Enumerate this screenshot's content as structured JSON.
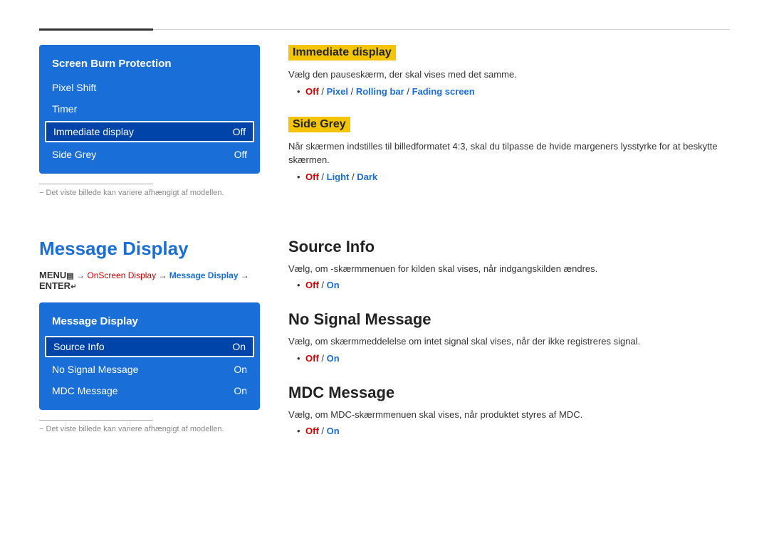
{
  "topDivider": true,
  "screenBurn": {
    "title": "Screen Burn Protection",
    "items": [
      {
        "label": "Pixel Shift",
        "value": "",
        "selected": false
      },
      {
        "label": "Timer",
        "value": "",
        "selected": false
      },
      {
        "label": "Immediate display",
        "value": "Off",
        "selected": true
      },
      {
        "label": "Side Grey",
        "value": "Off",
        "selected": false
      }
    ]
  },
  "immediateDisplay": {
    "title": "Immediate display",
    "desc": "Vælg den pauseskærm, der skal vises med det samme.",
    "options": "Off / Pixel / Rolling bar / Fading screen",
    "optionParts": [
      "Off",
      " / ",
      "Pixel",
      " / ",
      "Rolling bar",
      " / ",
      "Fading screen"
    ]
  },
  "sideGrey": {
    "title": "Side Grey",
    "desc": "Når skærmen indstilles til billedformatet 4:3, skal du tilpasse de hvide margeners lysstyrke for at beskytte skærmen.",
    "optionParts": [
      "Off",
      " / ",
      "Light",
      " / ",
      "Dark"
    ]
  },
  "note1": "− Det viste billede kan variere afhængigt af modellen.",
  "messageDisplay": {
    "heading": "Message Display",
    "breadcrumb": {
      "menu": "MENU",
      "menuIcon": "≡",
      "arrow1": "→",
      "part1": "OnScreen Display",
      "arrow2": "→",
      "part2": "Message Display",
      "arrow3": "→",
      "enterText": "ENTER"
    },
    "menuTitle": "Message Display",
    "items": [
      {
        "label": "Source Info",
        "value": "On",
        "selected": true
      },
      {
        "label": "No Signal Message",
        "value": "On",
        "selected": false
      },
      {
        "label": "MDC Message",
        "value": "On",
        "selected": false
      }
    ]
  },
  "sourceInfo": {
    "title": "Source Info",
    "desc": "Vælg, om -skærmmenuen for kilden skal vises, når indgangskilden ændres.",
    "optionParts": [
      "Off",
      " / ",
      "On"
    ]
  },
  "noSignalMessage": {
    "title": "No Signal Message",
    "desc": "Vælg, om skærmmeddelelse om intet signal skal vises, når der ikke registreres signal.",
    "optionParts": [
      "Off",
      " / ",
      "On"
    ]
  },
  "mdcMessage": {
    "title": "MDC Message",
    "desc": "Vælg, om MDC-skærmmenuen skal vises, når produktet styres af MDC.",
    "optionParts": [
      "Off",
      " / ",
      "On"
    ]
  },
  "note2": "− Det viste billede kan variere afhængigt af modellen."
}
